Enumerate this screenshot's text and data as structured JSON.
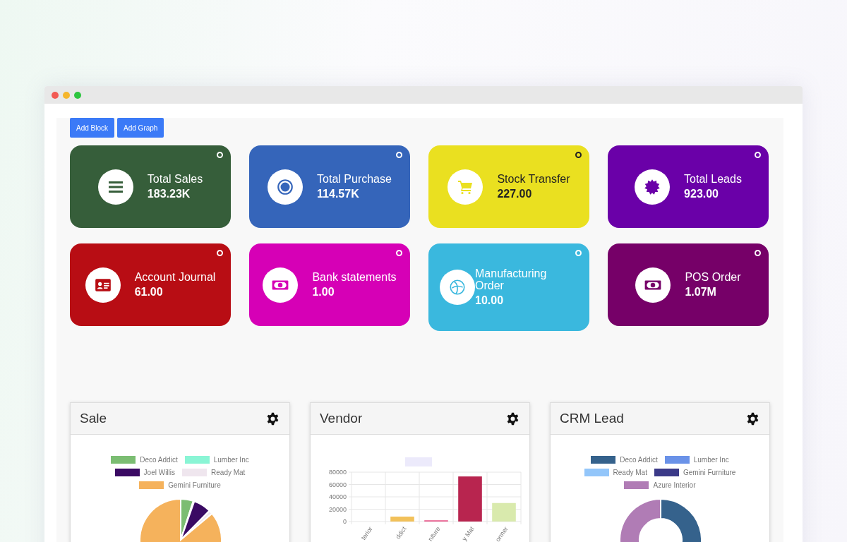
{
  "toolbar": {
    "buttons": [
      "Add Block",
      "Add Graph"
    ]
  },
  "cards": [
    {
      "title": "Total Sales",
      "value": "183.23K",
      "color": "#365e3a",
      "kind": "list"
    },
    {
      "title": "Total Purchase",
      "value": "114.57K",
      "color": "#3565ba",
      "kind": "target"
    },
    {
      "title": "Stock Transfer",
      "value": "227.00",
      "color": "#eae020",
      "kind": "cart"
    },
    {
      "title": "Total Leads",
      "value": "923.00",
      "color": "#6a00a8",
      "kind": "badge"
    },
    {
      "title": "Account Journal",
      "value": "61.00",
      "color": "#b80d14",
      "kind": "idcard"
    },
    {
      "title": "Bank statements",
      "value": "1.00",
      "color": "#d600b6",
      "kind": "money"
    },
    {
      "title": "Manufacturing Order",
      "value": "10.00",
      "color": "#3ab8de",
      "kind": "globe"
    },
    {
      "title": "POS Order",
      "value": "1.07M",
      "color": "#760068",
      "kind": "money"
    }
  ],
  "panels": [
    {
      "title": "Sale",
      "kind": "pie",
      "legend": [
        {
          "label": "Deco Addict",
          "color": "#7bbd72"
        },
        {
          "label": "Lumber Inc",
          "color": "#8af5d5"
        },
        {
          "label": "Joel Willis",
          "color": "#3a0a63"
        },
        {
          "label": "Ready Mat",
          "color": "#efe6ee"
        },
        {
          "label": "Gemini Furniture",
          "color": "#f5b25c"
        }
      ]
    },
    {
      "title": "Vendor",
      "kind": "bar",
      "chart_data": {
        "type": "bar",
        "grid": true,
        "categories": [
          "terior",
          "ddict",
          "niture",
          "y Mat",
          "ormer"
        ],
        "yticks": [
          0,
          20000,
          40000,
          60000,
          80000
        ],
        "ylim": [
          0,
          80000
        ],
        "series": [
          {
            "color": "#eceafb",
            "colors": [
              "#8fb3e8",
              "#f2c15a",
              "#e8588a",
              "#b8254f",
              "#d9eaad"
            ],
            "values": [
              0,
              8000,
              2000,
              73000,
              30000
            ]
          }
        ]
      }
    },
    {
      "title": "CRM Lead",
      "kind": "donut",
      "legend": [
        {
          "label": "Deco Addict",
          "color": "#35628c"
        },
        {
          "label": "Lumber Inc",
          "color": "#6a92e8"
        },
        {
          "label": "Ready Mat",
          "color": "#93c6fa"
        },
        {
          "label": "Gemini Furniture",
          "color": "#3b3a88"
        },
        {
          "label": "Azure Interior",
          "color": "#b07cb5"
        }
      ]
    }
  ]
}
